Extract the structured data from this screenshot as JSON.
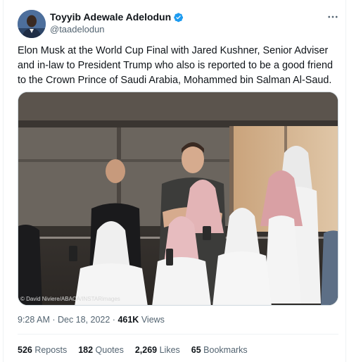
{
  "tweet": {
    "author": {
      "display_name": "Toyyib Adewale Adelodun",
      "handle": "@taadelodun",
      "verified": true
    },
    "more_icon": "more-horizontal-icon",
    "text": "Elon Musk at the World Cup Final with Jared Kushner, Senior Adviser and in-law to President Trump who also is reported to be a good friend to the Crown Prince of Saudi Arabia, Mohammed bin Salman Al-Saud.",
    "media": {
      "credit": "© David Niviere/ABACA/INSTARimages"
    },
    "timestamp": "9:28 AM · Dec 18, 2022 · ",
    "views_count": "461K",
    "views_label": " Views",
    "stats": {
      "reposts_count": "526",
      "reposts_label": " Reposts",
      "quotes_count": "182",
      "quotes_label": " Quotes",
      "likes_count": "2,269",
      "likes_label": " Likes",
      "bookmarks_count": "65",
      "bookmarks_label": " Bookmarks"
    },
    "colors": {
      "verified": "#1d9bf0",
      "text": "#0f1419",
      "secondary": "#536471"
    }
  }
}
